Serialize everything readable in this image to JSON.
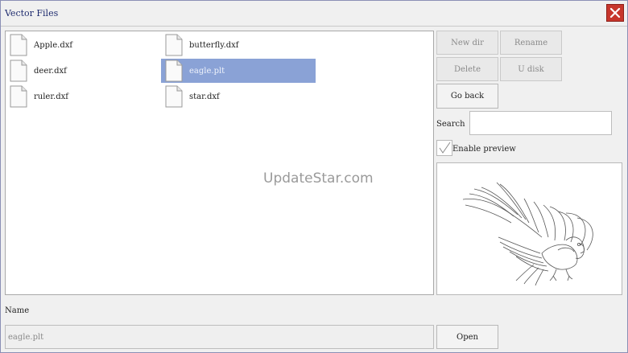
{
  "window": {
    "title": "Vector Files"
  },
  "files": [
    {
      "name": "Apple.dxf",
      "selected": false
    },
    {
      "name": "butterfly.dxf",
      "selected": false
    },
    {
      "name": "deer.dxf",
      "selected": false
    },
    {
      "name": "eagle.plt",
      "selected": true
    },
    {
      "name": "ruler.dxf",
      "selected": false
    },
    {
      "name": "star.dxf",
      "selected": false
    }
  ],
  "watermark": "UpdateStar.com",
  "buttons": {
    "new_dir": "New dir",
    "rename": "Rename",
    "delete": "Delete",
    "u_disk": "U disk",
    "go_back": "Go back",
    "open": "Open"
  },
  "search": {
    "label": "Search",
    "value": ""
  },
  "preview": {
    "label": "Enable preview",
    "checked": true
  },
  "name": {
    "label": "Name",
    "value": "eagle.plt"
  },
  "colors": {
    "selection": "#8aa2d6",
    "close": "#c7362c",
    "title": "#1e2b6e"
  }
}
